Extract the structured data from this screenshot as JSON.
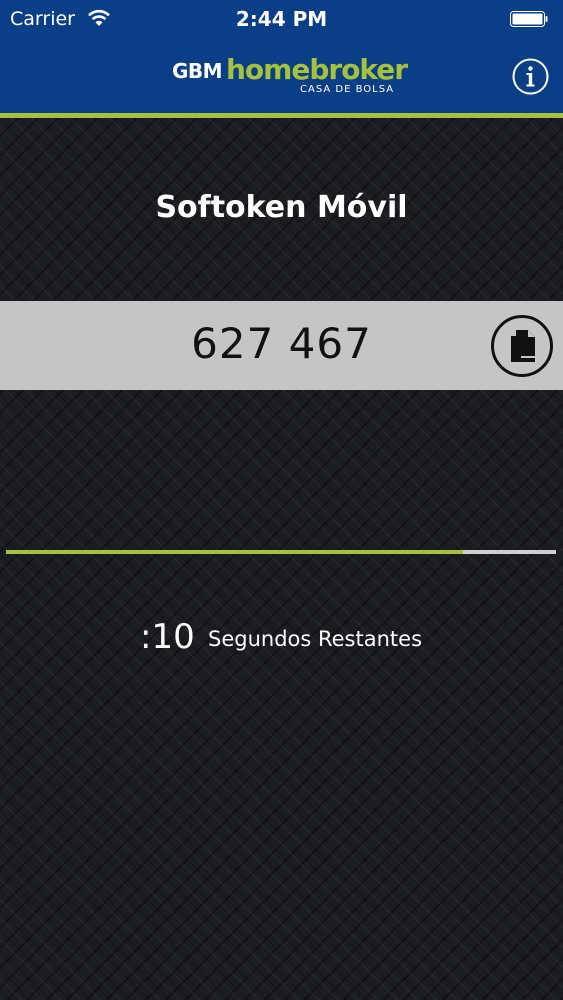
{
  "status_bar": {
    "carrier": "Carrier",
    "time": "2:44 PM"
  },
  "header": {
    "logo_gbm": "GBM",
    "logo_homebroker": "homebroker",
    "logo_subtitle": "CASA DE BOLSA",
    "info_icon": "info-icon"
  },
  "title": "Softoken Móvil",
  "token": {
    "code": "627 467",
    "copy_icon": "copy-icon"
  },
  "timer": {
    "progress": 0.83,
    "seconds": ":10",
    "label": "Segundos Restantes"
  },
  "colors": {
    "header_bg": "#0a3f87",
    "accent": "#a4c23b",
    "token_band": "#c5c5c5"
  }
}
